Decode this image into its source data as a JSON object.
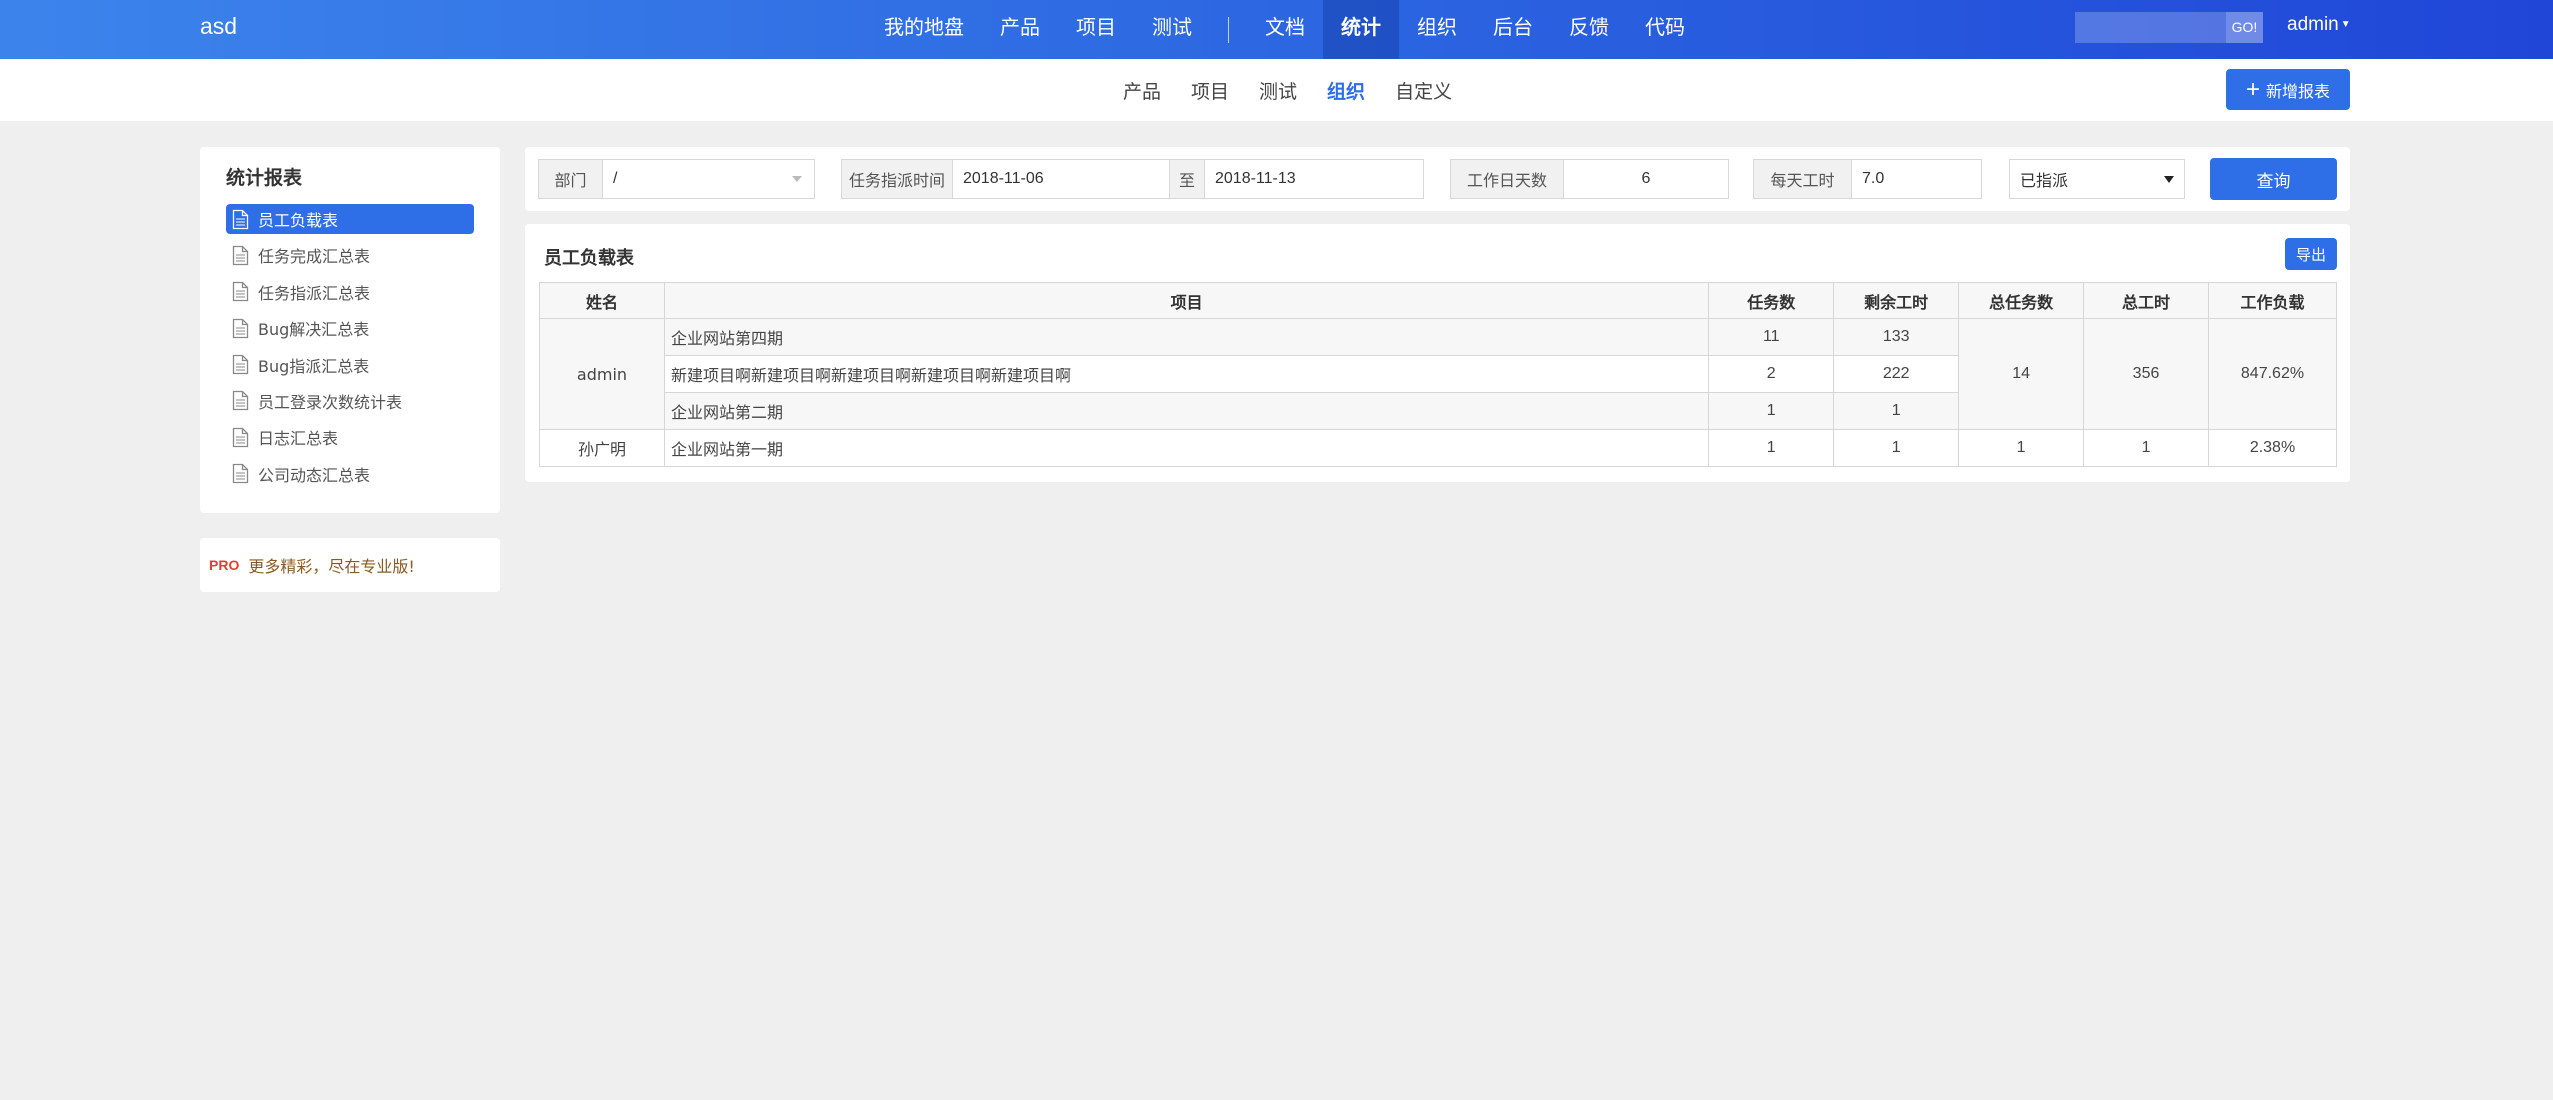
{
  "header": {
    "brand": "asd",
    "nav": [
      {
        "label": "我的地盘"
      },
      {
        "label": "产品"
      },
      {
        "label": "项目"
      },
      {
        "label": "测试"
      },
      {
        "label": "文档"
      },
      {
        "label": "统计",
        "active": true
      },
      {
        "label": "组织"
      },
      {
        "label": "后台"
      },
      {
        "label": "反馈"
      },
      {
        "label": "代码"
      }
    ],
    "search": {
      "value": "",
      "button": "GO!"
    },
    "user": "admin"
  },
  "subnav": {
    "items": [
      {
        "label": "产品"
      },
      {
        "label": "项目"
      },
      {
        "label": "测试"
      },
      {
        "label": "组织",
        "active": true
      },
      {
        "label": "自定义"
      }
    ],
    "new_report_label": "新增报表"
  },
  "sidebar": {
    "title": "统计报表",
    "items": [
      {
        "label": "员工负载表",
        "active": true
      },
      {
        "label": "任务完成汇总表"
      },
      {
        "label": "任务指派汇总表"
      },
      {
        "label": "Bug解决汇总表"
      },
      {
        "label": "Bug指派汇总表"
      },
      {
        "label": "员工登录次数统计表"
      },
      {
        "label": "日志汇总表"
      },
      {
        "label": "公司动态汇总表"
      }
    ],
    "pro": {
      "badge": "PRO",
      "text": "更多精彩，尽在专业版!"
    }
  },
  "filters": {
    "dept_label": "部门",
    "dept_value": "/",
    "assign_time_label": "任务指派时间",
    "date_from": "2018-11-06",
    "to_label": "至",
    "date_to": "2018-11-13",
    "workdays_label": "工作日天数",
    "workdays_value": "6",
    "hours_label": "每天工时",
    "hours_value": "7.0",
    "status_value": "已指派",
    "query_label": "查询"
  },
  "report": {
    "title": "员工负载表",
    "export_label": "导出",
    "columns": [
      "姓名",
      "项目",
      "任务数",
      "剩余工时",
      "总任务数",
      "总工时",
      "工作负载"
    ],
    "rows": [
      {
        "name": "admin",
        "projects": [
          {
            "project": "企业网站第四期",
            "tasks": "11",
            "left": "133"
          },
          {
            "project": "新建项目啊新建项目啊新建项目啊新建项目啊新建项目啊",
            "tasks": "2",
            "left": "222"
          },
          {
            "project": "企业网站第二期",
            "tasks": "1",
            "left": "1"
          }
        ],
        "total_tasks": "14",
        "total_hours": "356",
        "workload": "847.62%"
      },
      {
        "name": "孙广明",
        "projects": [
          {
            "project": "企业网站第一期",
            "tasks": "1",
            "left": "1"
          }
        ],
        "total_tasks": "1",
        "total_hours": "1",
        "workload": "2.38%"
      }
    ]
  }
}
